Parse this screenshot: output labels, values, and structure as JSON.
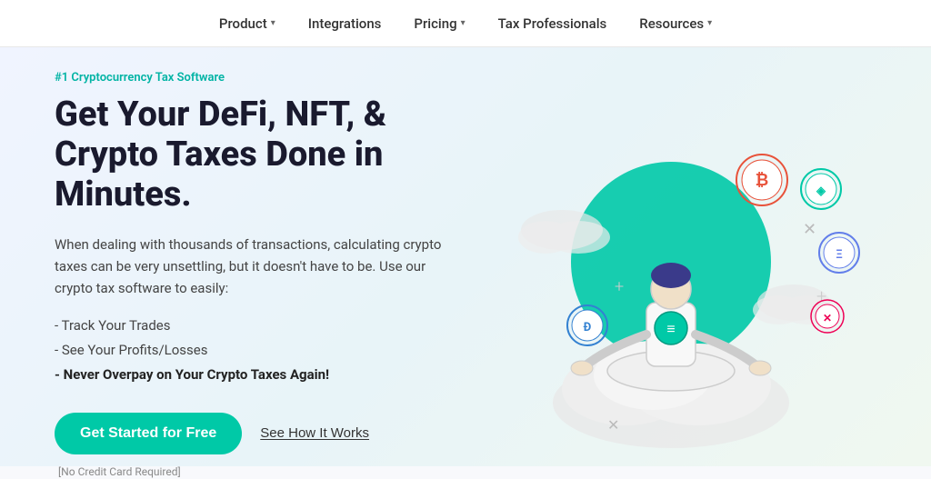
{
  "nav": {
    "items": [
      {
        "label": "Product",
        "hasDropdown": true
      },
      {
        "label": "Integrations",
        "hasDropdown": false
      },
      {
        "label": "Pricing",
        "hasDropdown": true
      },
      {
        "label": "Tax Professionals",
        "hasDropdown": false
      },
      {
        "label": "Resources",
        "hasDropdown": true
      }
    ]
  },
  "hero": {
    "badge": "#1 Cryptocurrency Tax Software",
    "title": "Get Your DeFi, NFT, & Crypto Taxes Done in Minutes.",
    "description": "When dealing with thousands of transactions, calculating crypto taxes can be very unsettling, but it doesn't have to be. Use our crypto tax software to easily:",
    "features": [
      {
        "text": "- Track Your Trades",
        "bold": false
      },
      {
        "text": "- See Your Profits/Losses",
        "bold": false
      },
      {
        "text": "- Never Overpay on Your Crypto Taxes Again!",
        "bold": true
      }
    ],
    "cta_primary": "Get Started for Free",
    "cta_secondary": "See How It Works",
    "no_cc_label": "[No Credit Card Required]"
  }
}
